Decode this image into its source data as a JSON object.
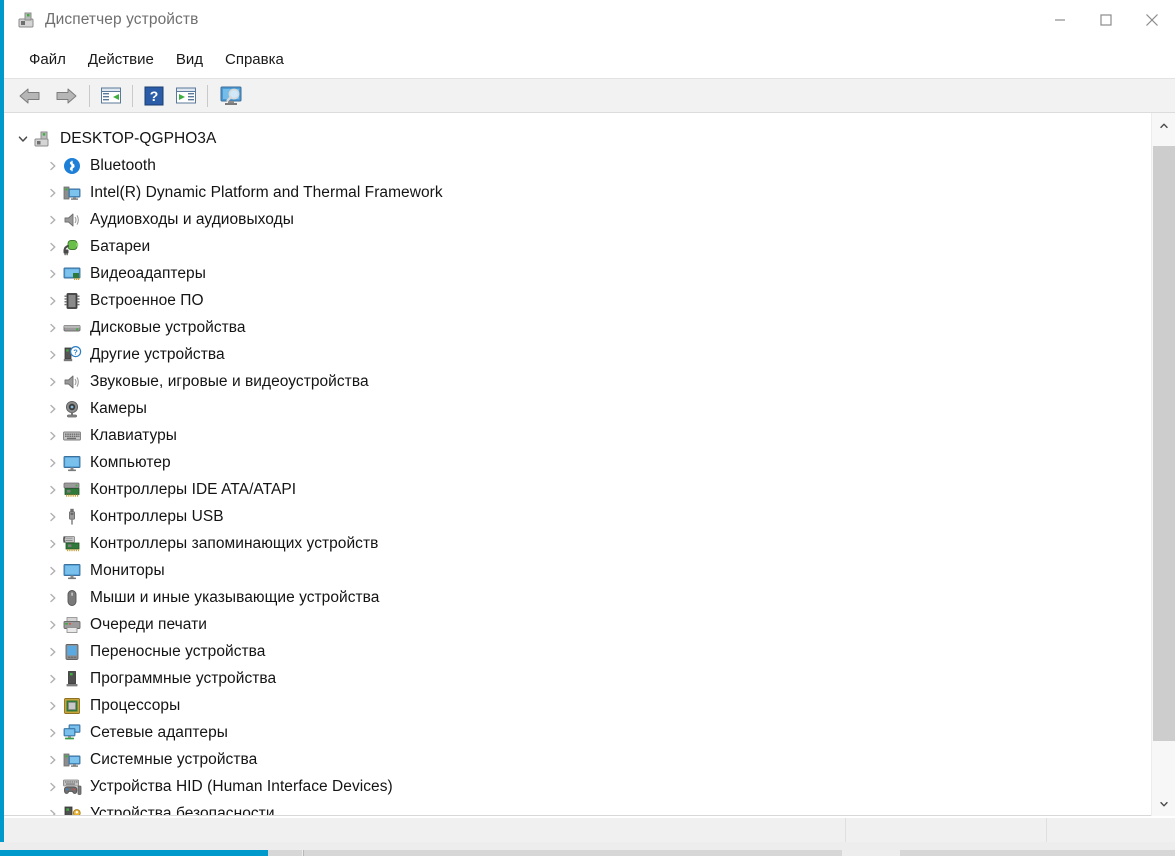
{
  "window": {
    "title": "Диспетчер устройств",
    "title_icon": "device-manager-icon",
    "controls": {
      "minimize": "minimize-icon",
      "maximize": "maximize-icon",
      "close": "close-icon"
    },
    "accent_color": "#0099cc"
  },
  "menu": {
    "items": [
      {
        "label": "Файл"
      },
      {
        "label": "Действие"
      },
      {
        "label": "Вид"
      },
      {
        "label": "Справка"
      }
    ]
  },
  "toolbar": {
    "buttons": [
      {
        "name": "back-button",
        "icon": "back-arrow-icon"
      },
      {
        "name": "forward-button",
        "icon": "forward-arrow-icon"
      },
      {
        "name": "properties-button",
        "icon": "properties-icon"
      },
      {
        "name": "help-button",
        "icon": "help-question-icon"
      },
      {
        "name": "show-hidden-button",
        "icon": "show-panel-icon"
      },
      {
        "name": "scan-hardware-button",
        "icon": "scan-monitor-icon"
      }
    ]
  },
  "tree": {
    "root": {
      "label": "DESKTOP-QGPHO3A",
      "icon": "computer-root-icon",
      "expanded": true
    },
    "items": [
      {
        "label": "Bluetooth",
        "icon": "bluetooth-icon"
      },
      {
        "label": "Intel(R) Dynamic Platform and Thermal Framework",
        "icon": "system-device-icon"
      },
      {
        "label": "Аудиовходы и аудиовыходы",
        "icon": "speaker-icon"
      },
      {
        "label": "Батареи",
        "icon": "battery-icon"
      },
      {
        "label": "Видеоадаптеры",
        "icon": "display-adapter-icon"
      },
      {
        "label": "Встроенное ПО",
        "icon": "firmware-chip-icon"
      },
      {
        "label": "Дисковые устройства",
        "icon": "disk-drive-icon"
      },
      {
        "label": "Другие устройства",
        "icon": "unknown-device-icon"
      },
      {
        "label": "Звуковые, игровые и видеоустройства",
        "icon": "speaker-icon"
      },
      {
        "label": "Камеры",
        "icon": "camera-icon"
      },
      {
        "label": "Клавиатуры",
        "icon": "keyboard-icon"
      },
      {
        "label": "Компьютер",
        "icon": "monitor-icon"
      },
      {
        "label": "Контроллеры IDE ATA/ATAPI",
        "icon": "ide-controller-icon"
      },
      {
        "label": "Контроллеры USB",
        "icon": "usb-icon"
      },
      {
        "label": "Контроллеры запоминающих устройств",
        "icon": "storage-controller-icon"
      },
      {
        "label": "Мониторы",
        "icon": "monitor-icon"
      },
      {
        "label": "Мыши и иные указывающие устройства",
        "icon": "mouse-icon"
      },
      {
        "label": "Очереди печати",
        "icon": "printer-icon"
      },
      {
        "label": "Переносные устройства",
        "icon": "portable-device-icon"
      },
      {
        "label": "Программные устройства",
        "icon": "software-device-icon"
      },
      {
        "label": "Процессоры",
        "icon": "processor-chip-icon"
      },
      {
        "label": "Сетевые адаптеры",
        "icon": "network-adapter-icon"
      },
      {
        "label": "Системные устройства",
        "icon": "system-device-icon"
      },
      {
        "label": "Устройства HID (Human Interface Devices)",
        "icon": "hid-icon"
      },
      {
        "label": "Устройства безопасности",
        "icon": "security-device-icon"
      }
    ]
  },
  "scrollbar": {
    "up_arrow": "chevron-up-icon",
    "down_arrow": "chevron-down-icon"
  },
  "statusbar": {
    "segment_1": "",
    "segment_2": "",
    "segment_3": ""
  }
}
